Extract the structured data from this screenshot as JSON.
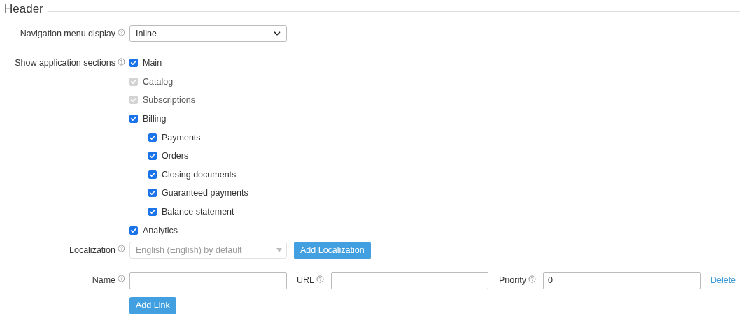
{
  "section_title": "Header",
  "navigation_menu": {
    "label": "Navigation menu display",
    "value": "Inline"
  },
  "sections": {
    "label": "Show application sections",
    "items": [
      {
        "label": "Main",
        "checked": true,
        "disabled": false
      },
      {
        "label": "Catalog",
        "checked": true,
        "disabled": true
      },
      {
        "label": "Subscriptions",
        "checked": true,
        "disabled": true
      },
      {
        "label": "Billing",
        "checked": true,
        "disabled": false,
        "children": [
          {
            "label": "Payments",
            "checked": true,
            "disabled": false
          },
          {
            "label": "Orders",
            "checked": true,
            "disabled": false
          },
          {
            "label": "Closing documents",
            "checked": true,
            "disabled": false
          },
          {
            "label": "Guaranteed payments",
            "checked": true,
            "disabled": false
          },
          {
            "label": "Balance statement",
            "checked": true,
            "disabled": false
          }
        ]
      },
      {
        "label": "Analytics",
        "checked": true,
        "disabled": false
      }
    ]
  },
  "localization": {
    "label": "Localization",
    "value": "English (English) by default",
    "disabled": true,
    "button": "Add Localization"
  },
  "link": {
    "name_label": "Name",
    "url_label": "URL",
    "priority_label": "Priority",
    "priority_value": "0",
    "delete": "Delete"
  },
  "add_link_button": "Add Link"
}
